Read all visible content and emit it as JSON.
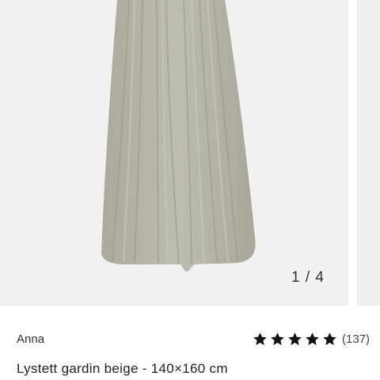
{
  "product": {
    "image_alt": "Lystett gardin beige",
    "image_counter": "1 / 4",
    "brand": "Anna",
    "rating_stars": 5,
    "rating_count": "(137)",
    "title": "Lystett gardin beige - 140×160 cm"
  },
  "colors": {
    "curtain": "#b4b4a6",
    "star": "#111111",
    "gallery_bg": "#f1f1f1"
  }
}
